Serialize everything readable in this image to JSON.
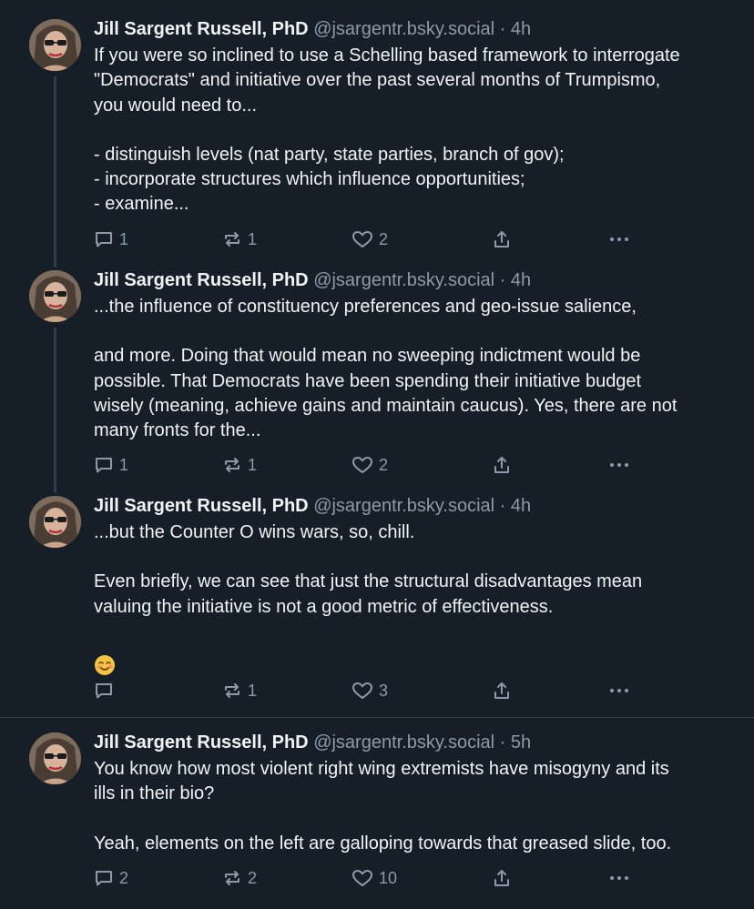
{
  "posts": [
    {
      "author": "Jill Sargent Russell, PhD",
      "handle": "@jsargentr.bsky.social",
      "separator": "·",
      "time": "4h",
      "lines": [
        "If you were so inclined to use a Schelling based framework to interrogate",
        "\"Democrats\" and initiative over the past several months of Trumpismo,",
        "you would need to...",
        "",
        "- distinguish levels (nat party, state parties, branch of gov);",
        "- incorporate structures which influence opportunities;",
        "- examine..."
      ],
      "replies": "1",
      "reposts": "1",
      "likes": "2"
    },
    {
      "author": "Jill Sargent Russell, PhD",
      "handle": "@jsargentr.bsky.social",
      "separator": "·",
      "time": "4h",
      "lines": [
        "...the influence of constituency preferences and geo-issue salience,",
        "",
        "and more. Doing that would mean no sweeping indictment would be",
        "possible. That Democrats have been spending their initiative budget",
        "wisely (meaning, achieve gains and maintain caucus). Yes, there are not",
        "many fronts for the..."
      ],
      "replies": "1",
      "reposts": "1",
      "likes": "2"
    },
    {
      "author": "Jill Sargent Russell, PhD",
      "handle": "@jsargentr.bsky.social",
      "separator": "·",
      "time": "4h",
      "lines": [
        "...but the Counter O wins wars, so, chill.",
        "",
        "Even briefly, we can see that just the structural disadvantages mean",
        "valuing the initiative is not a good metric of effectiveness."
      ],
      "emoji": "smiling-face-emoji",
      "replies": "",
      "reposts": "1",
      "likes": "3"
    },
    {
      "author": "Jill Sargent Russell, PhD",
      "handle": "@jsargentr.bsky.social",
      "separator": "·",
      "time": "5h",
      "lines": [
        "You know how most violent right wing extremists have misogyny and its",
        "ills in their bio?",
        "",
        "Yeah, elements on the left are galloping towards that greased slide, too."
      ],
      "replies": "2",
      "reposts": "2",
      "likes": "10"
    }
  ],
  "colors": {
    "background": "#161e27",
    "text": "#f1f3f5",
    "muted": "#8d9aab",
    "thread_line": "#2e3d4f"
  },
  "icons": [
    "reply-icon",
    "repost-icon",
    "like-icon",
    "share-icon",
    "more-icon"
  ]
}
